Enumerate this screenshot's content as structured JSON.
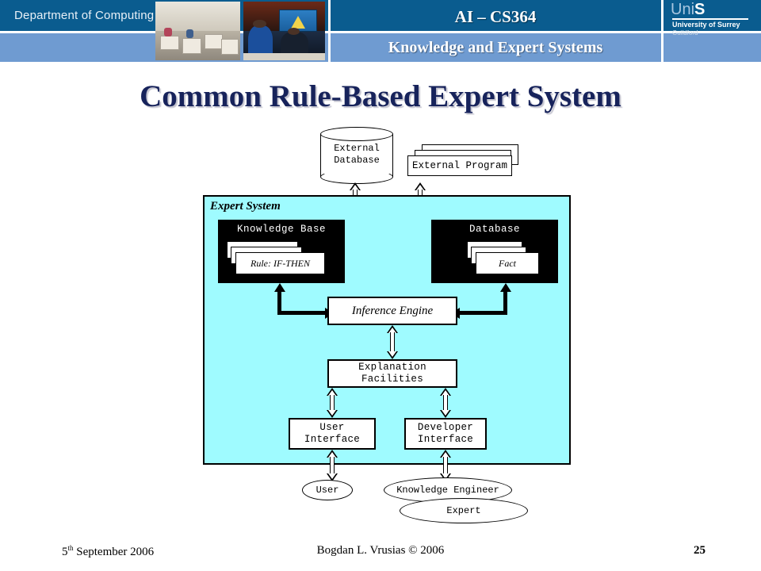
{
  "header": {
    "department": "Department of Computing",
    "course": "AI – CS364",
    "module": "Knowledge and Expert Systems",
    "logo": {
      "prefix": "Uni",
      "suffix": "S",
      "university": "University of Surrey",
      "city": "Guildford"
    }
  },
  "slide": {
    "title": "Common Rule-Based Expert System"
  },
  "diagram": {
    "external_database": "External\nDatabase",
    "external_database_line1": "External",
    "external_database_line2": "Database",
    "external_program": "External Program",
    "expert_system_label": "Expert System",
    "knowledge_base": {
      "title": "Knowledge Base",
      "card": "Rule: IF-THEN"
    },
    "database": {
      "title": "Database",
      "card": "Fact"
    },
    "inference_engine": "Inference Engine",
    "explanation_facilities": "Explanation Facilities",
    "user_interface": "User Interface",
    "developer_interface": "Developer Interface",
    "user": "User",
    "knowledge_engineer": "Knowledge Engineer",
    "expert": "Expert",
    "colors": {
      "expert_system_fill": "#9ffbff",
      "panel_fill": "#000000",
      "box_fill": "#ffffff"
    }
  },
  "footer": {
    "date": "5",
    "date_sup": "th",
    "date_rest": " September 2006",
    "author": "Bogdan L. Vrusias © 2006",
    "page": "25"
  }
}
